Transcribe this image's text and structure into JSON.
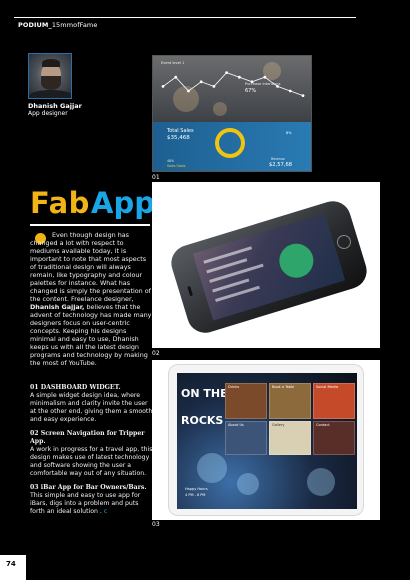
{
  "header": {
    "section_bold": "PODIUM_",
    "section_rest": "15mmofFame"
  },
  "author": {
    "name": "Dhanish Gajjar",
    "role": "App designer"
  },
  "title": {
    "part1": "Fab",
    "part2": "App",
    "color1": "#f2b315",
    "color2": "#19a6e6"
  },
  "article": {
    "intro_lead": "Even though design has changed a lot with respect to mediums available today, it is important to note that most aspects of traditional design will always remain, like typography and colour palettes for instance. What has changed is simply the presentation of the content. Freelance designer,",
    "intro_name": "Dhanish Gajjar,",
    "intro_tail": "believes that the advent of technology has made many designers focus on user-centric concepts.  Keeping his designs minimal and easy to use, Dhanish keeps us with all the latest design programs and technology by making the most of YouTube.",
    "items": [
      {
        "title": "01 DASHBOARD WIDGET.",
        "desc": "A simple widget design idea, where minimalism and clarity invite the user at the other end, giving them a smooth and easy experience."
      },
      {
        "title": "02 Screen Navigation for Tripper App.",
        "desc": "A work in progress for a travel app, this design makes use of latest technology and software showing the user a comfortable way out of any situation."
      },
      {
        "title": "03 iBar App for Bar Owners/Bars.",
        "desc": "This simple and easy to use app for iBars, digs into a problem and puts forth an ideal solution ."
      }
    ],
    "end_mark": "c"
  },
  "figures": {
    "fig1": {
      "caption": "01",
      "event_label": "Event level 1",
      "purchase_label": "Purchase Intentions",
      "purchase_pct": "67%",
      "total_sales_title": "Total Sales",
      "total_sales_amount": "$35,468",
      "right_pct": "8%",
      "right_small": "Revenue",
      "right_big": "$2,57,68",
      "sub_left": "48%",
      "sub_left2": "Sales Goals",
      "line_values": [
        6,
        8,
        5,
        7,
        6,
        9,
        8,
        7,
        8,
        6,
        5,
        4
      ]
    },
    "fig2": {
      "caption": "02"
    },
    "fig3": {
      "caption": "03",
      "logo_on": "ON THE",
      "logo_the": "",
      "logo_rocks": "ROCKS",
      "tiles": [
        "Drinks",
        "Book a Table",
        "Social Media",
        "About Us",
        "Gallery",
        "Contact"
      ],
      "hours_a": "Happy Hours",
      "hours_b": "4 PM - 8 PM"
    }
  },
  "page_number": "74"
}
